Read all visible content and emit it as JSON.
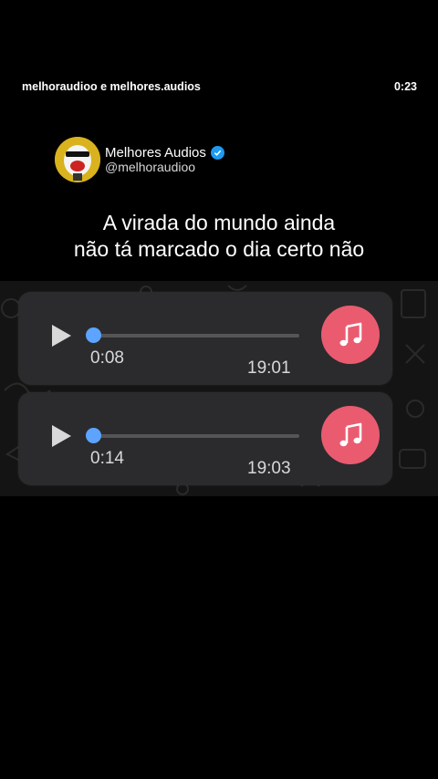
{
  "top_bar": {
    "author": "melhoraudioo e melhores.audios",
    "time": "0:23"
  },
  "post": {
    "account_name": "Melhores Audios",
    "account_handle": "@melhoraudioo",
    "caption_line1": "A virada do mundo ainda",
    "caption_line2": "não tá marcado o dia certo não"
  },
  "voice_messages": [
    {
      "duration": "0:08",
      "sent_time": "19:01",
      "progress": 0.0
    },
    {
      "duration": "0:14",
      "sent_time": "19:03",
      "progress": 0.0
    }
  ],
  "colors": {
    "background": "#000000",
    "bubble": "#2b2b2d",
    "accent_blue": "#5ca4ff",
    "music_button": "#ea5b70",
    "verified_badge": "#1d9bf0"
  },
  "icons": {
    "play": "play-icon",
    "music": "music-note-icon",
    "verified": "verified-badge-icon"
  }
}
